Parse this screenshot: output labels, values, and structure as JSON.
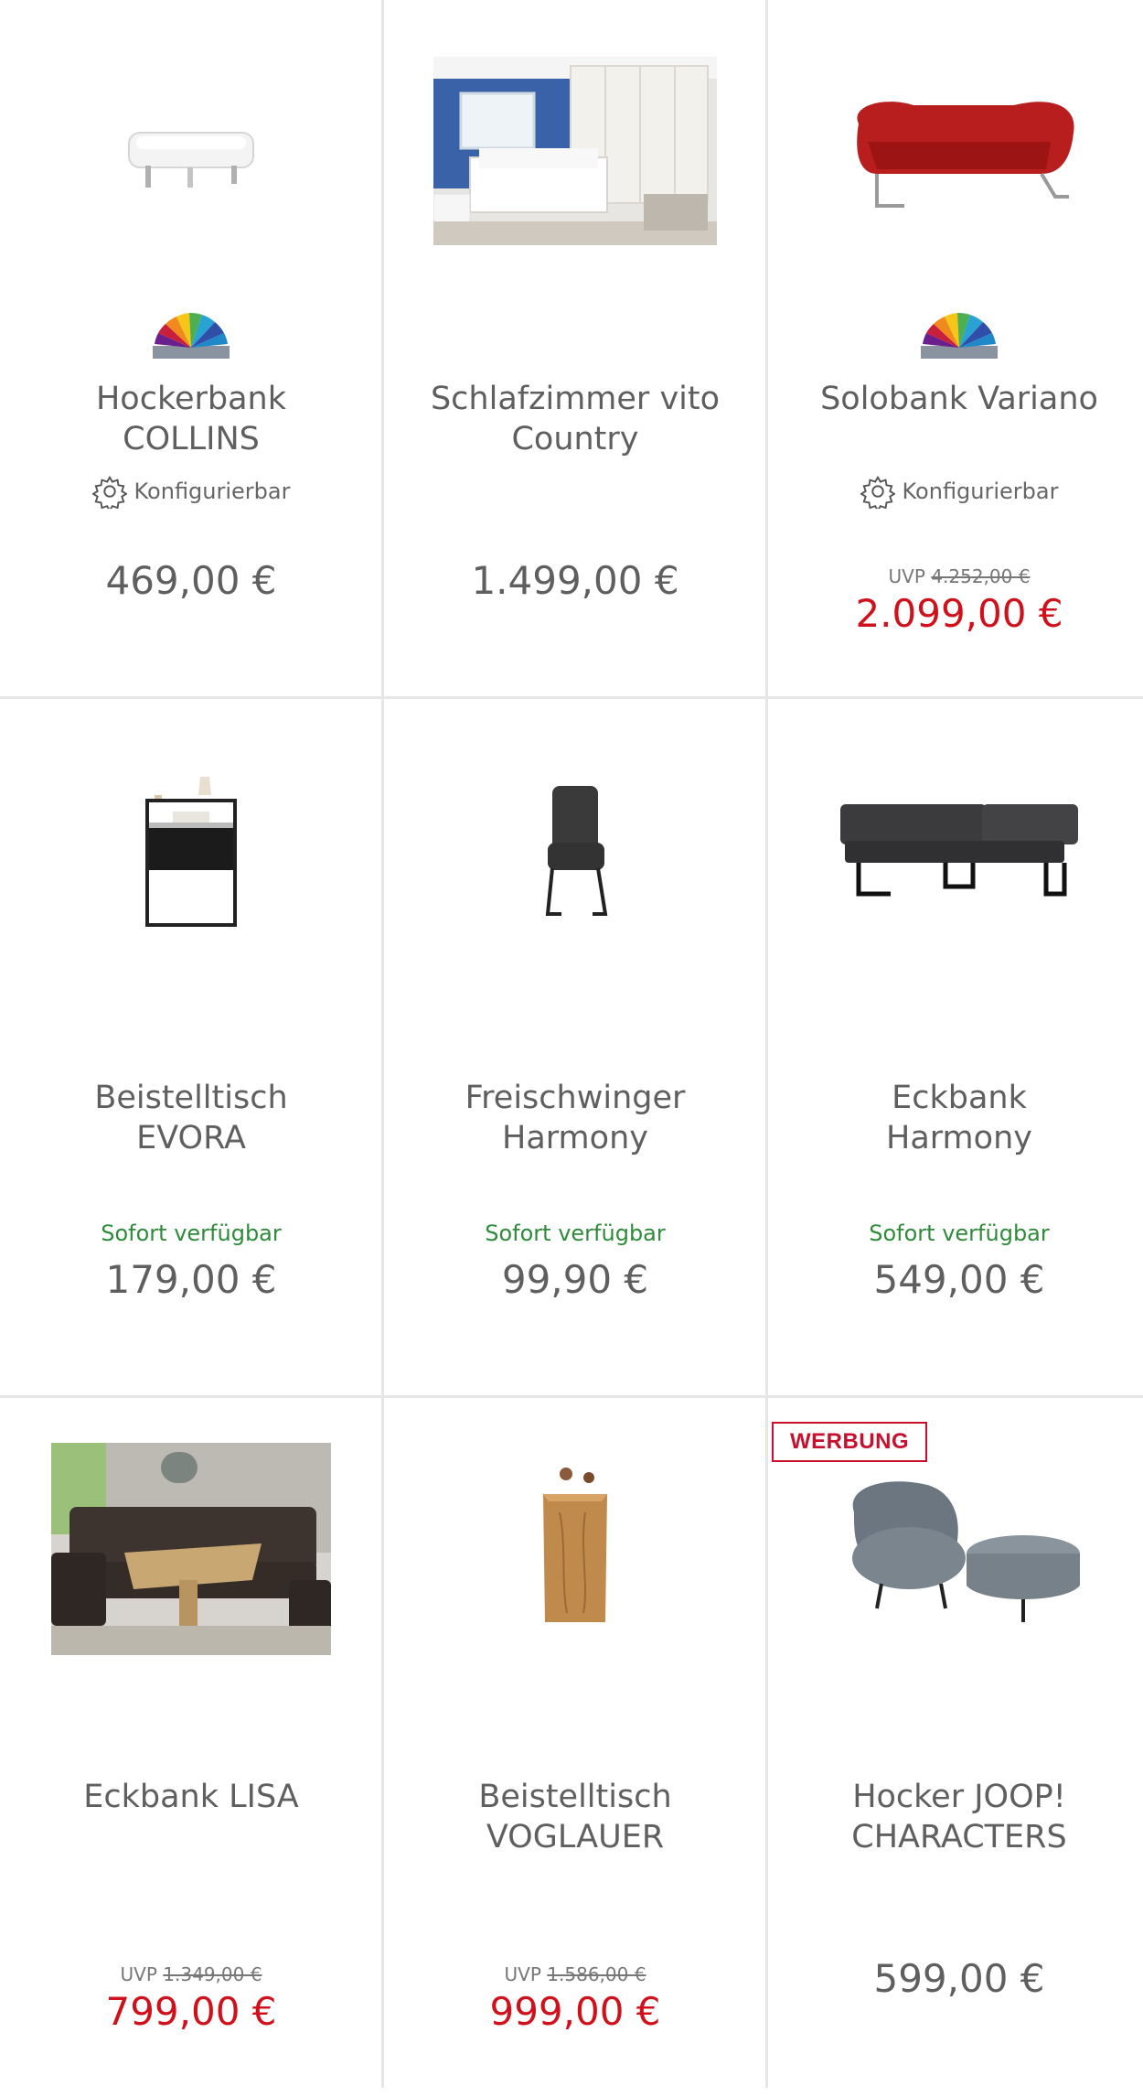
{
  "products": [
    {
      "title": "Hockerbank COLLINS",
      "image_icon": "white-footstool-image",
      "color_fan": true,
      "configurable_label": "Konfigurierbar",
      "price": "469,00 €",
      "sale": false
    },
    {
      "title": "Schlafzimmer vito Country",
      "image_icon": "bedroom-photo-image",
      "price": "1.499,00 €",
      "sale": false
    },
    {
      "title": "Solobank Variano",
      "image_icon": "red-bench-image",
      "color_fan": true,
      "configurable_label": "Konfigurierbar",
      "uvp_label": "UVP",
      "uvp_old": "4.252,00 €",
      "price": "2.099,00 €",
      "sale": true
    },
    {
      "title": "Beistelltisch EVORA",
      "image_icon": "side-table-image",
      "availability": "Sofort verfügbar",
      "price": "179,00 €",
      "sale": false
    },
    {
      "title": "Freischwinger Harmony",
      "image_icon": "cantilever-chair-image",
      "availability": "Sofort verfügbar",
      "price": "99,90 €",
      "sale": false
    },
    {
      "title": "Eckbank Harmony",
      "image_icon": "corner-bench-image",
      "availability": "Sofort verfügbar",
      "price": "549,00 €",
      "sale": false
    },
    {
      "title": "Eckbank LISA",
      "image_icon": "dining-corner-photo-image",
      "uvp_label": "UVP",
      "uvp_old": "1.349,00 €",
      "price": "799,00 €",
      "sale": true
    },
    {
      "title": "Beistelltisch VOGLAUER",
      "image_icon": "wood-side-table-image",
      "uvp_label": "UVP",
      "uvp_old": "1.586,00 €",
      "price": "999,00 €",
      "sale": true
    },
    {
      "title": "Hocker JOOP! CHARACTERS",
      "image_icon": "grey-lounge-chair-image",
      "badge": "WERBUNG",
      "price": "599,00 €",
      "sale": false
    }
  ],
  "colors": {
    "sale_red": "#d0101b",
    "available_green": "#2e8b3a",
    "badge_red": "#c8102e",
    "divider": "#e6e6e6"
  }
}
